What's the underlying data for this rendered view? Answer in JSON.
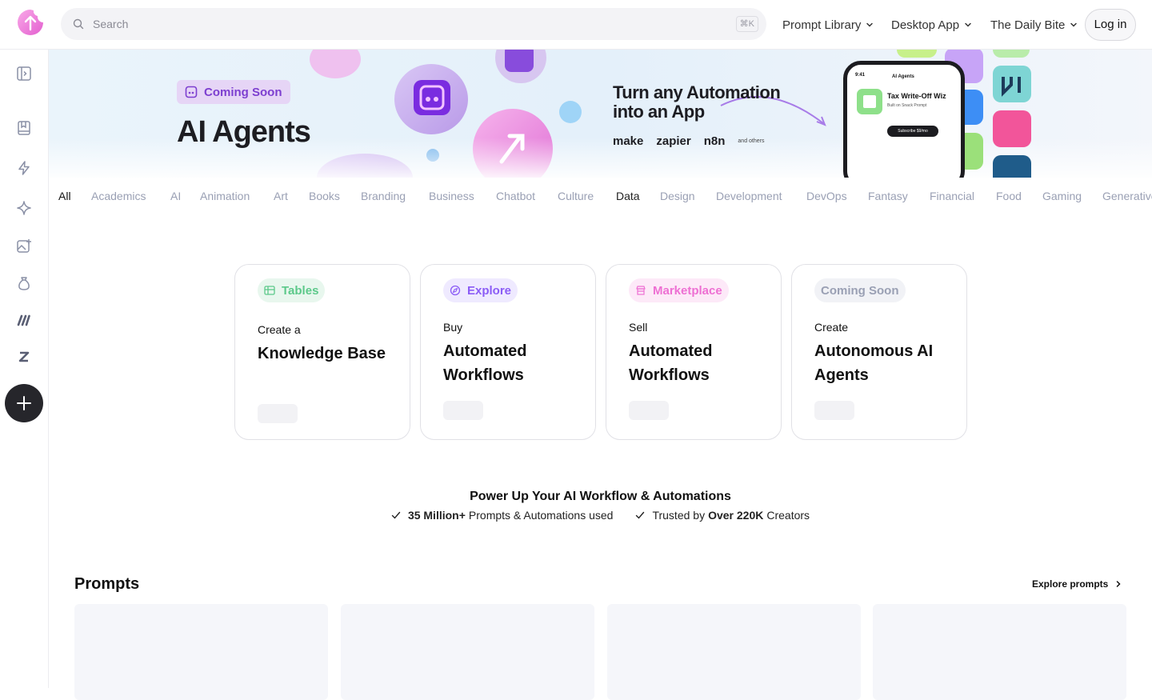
{
  "header": {
    "search_placeholder": "Search",
    "search_shortcut": "⌘K",
    "nav": [
      {
        "label": "Prompt Library"
      },
      {
        "label": "Desktop App"
      },
      {
        "label": "The Daily Bite"
      }
    ],
    "login_label": "Log in"
  },
  "banner": {
    "badge": "Coming Soon",
    "title": "AI Agents",
    "headline": "Turn any Automation into an App",
    "brands": [
      "make",
      "zapier",
      "n8n"
    ],
    "brands_note": "and others",
    "phone": {
      "time": "9:41",
      "title": "AI Agents",
      "app_name": "Tax Write-Off Wiz",
      "app_sub": "Built on Snack Prompt",
      "button": "Subscribe $9/mo"
    }
  },
  "categories": [
    "All",
    "Academics",
    "AI",
    "Animation",
    "Art",
    "Books",
    "Branding",
    "Business",
    "Chatbot",
    "Culture",
    "Data",
    "Design",
    "Development",
    "DevOps",
    "Fantasy",
    "Financial",
    "Food",
    "Gaming",
    "Generative"
  ],
  "cards": [
    {
      "pill": "Tables",
      "verb": "Create a",
      "title": "Knowledge Base"
    },
    {
      "pill": "Explore",
      "verb": "Buy",
      "title": "Automated Workflows"
    },
    {
      "pill": "Marketplace",
      "verb": "Sell",
      "title": "Automated Workflows"
    },
    {
      "pill": "Coming Soon",
      "verb": "Create",
      "title": "Autonomous AI Agents"
    }
  ],
  "power_up": {
    "title": "Power Up Your AI Workflow & Automations",
    "stat1_bold": "35 Million+",
    "stat1_rest": "Prompts & Automations used",
    "stat2_pre": "Trusted by",
    "stat2_bold": "Over 220K",
    "stat2_rest": "Creators"
  },
  "prompts": {
    "title": "Prompts",
    "explore_label": "Explore prompts"
  },
  "colors": {
    "brand_pink": "#f07bd6",
    "tables_green": "#5cc98a",
    "explore_purple": "#8b5cf6",
    "market_pink": "#ee6fd3",
    "soon_gray": "#9aa0b4"
  }
}
